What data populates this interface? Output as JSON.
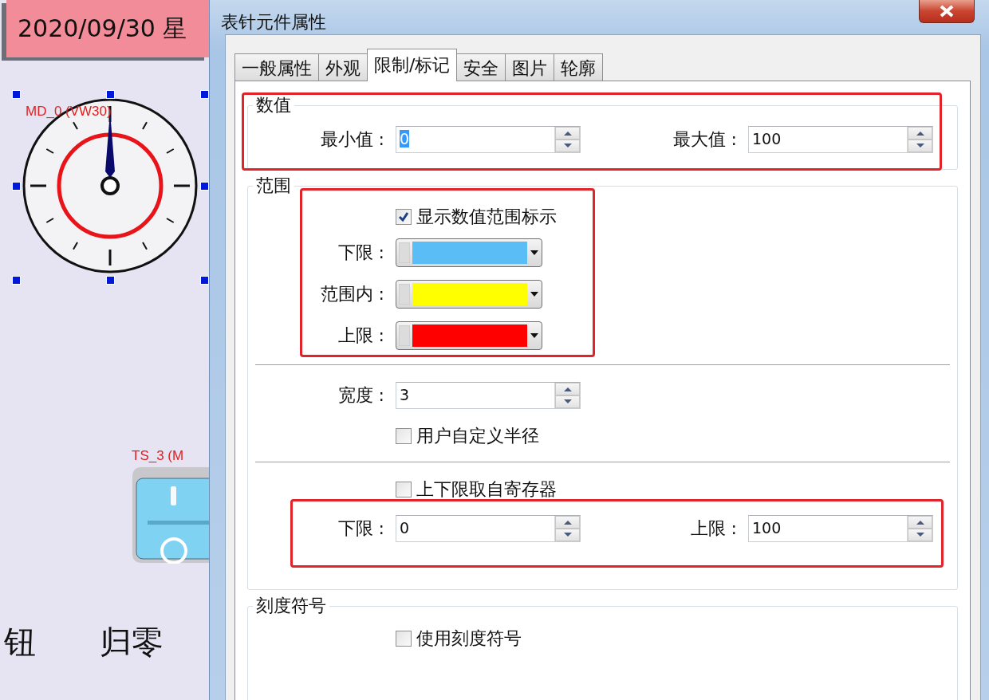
{
  "canvas": {
    "date_display": "2020/09/30 星",
    "gauge_label": "MD_0 (VW30)",
    "switch_label": "TS_3 (M",
    "captions": [
      "钮",
      "归零"
    ]
  },
  "dialog": {
    "title": "表针元件属性",
    "tabs": [
      {
        "label": "一般属性",
        "selected": false
      },
      {
        "label": "外观",
        "selected": false
      },
      {
        "label": "限制/标记",
        "selected": true
      },
      {
        "label": "安全",
        "selected": false
      },
      {
        "label": "图片",
        "selected": false
      },
      {
        "label": "轮廓",
        "selected": false
      }
    ],
    "value_group": {
      "title": "数值",
      "fields": [
        {
          "label": "最小值 :",
          "value": "0",
          "focused": true
        },
        {
          "label": "最大值 :",
          "value": "100",
          "focused": false
        }
      ]
    },
    "range_group": {
      "title": "范围",
      "show_range": {
        "label": "显示数值范围标示",
        "checked": true
      },
      "colors": [
        {
          "label": "下限 :",
          "color": "#5bbdf5"
        },
        {
          "label": "范围内 :",
          "color": "#ffff00"
        },
        {
          "label": "上限 :",
          "color": "#ff0000"
        }
      ],
      "width": {
        "label": "宽度 :",
        "value": "3",
        "focused": false
      },
      "custom_radius": {
        "label": "用户自定义半径",
        "checked": false
      },
      "from_register": {
        "label": "上下限取自寄存器",
        "checked": false
      },
      "limits": [
        {
          "label": "下限 :",
          "value": "0",
          "focused": false
        },
        {
          "label": "上限 :",
          "value": "100",
          "focused": false
        }
      ]
    },
    "scale_group": {
      "title": "刻度符号",
      "use_scale": {
        "label": "使用刻度符号",
        "checked": false
      }
    }
  }
}
